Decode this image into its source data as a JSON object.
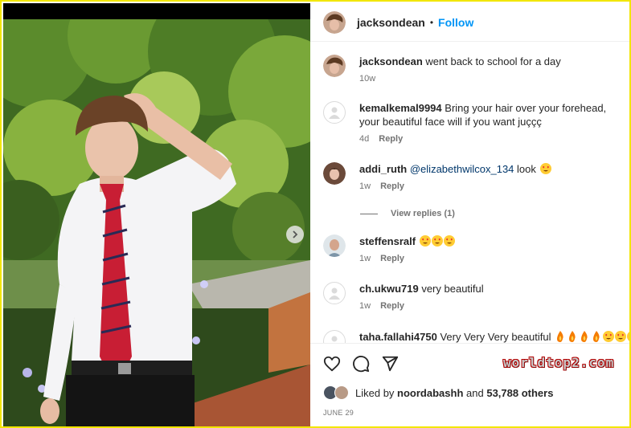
{
  "header": {
    "username": "jacksondean",
    "separator": "•",
    "follow_label": "Follow"
  },
  "caption": {
    "username": "jacksondean",
    "text": "went back to school for a day",
    "time": "10w"
  },
  "comments": [
    {
      "username": "kemalkemal9994",
      "text": "Bring your hair over your forehead, your beautiful face will if you want juççç",
      "time": "4d",
      "reply_label": "Reply"
    },
    {
      "username": "addi_ruth",
      "mention": "@elizabethwilcox_134",
      "text": "look",
      "emoji": "heart-eyes",
      "time": "1w",
      "reply_label": "Reply",
      "view_replies": "View replies (1)"
    },
    {
      "username": "steffensralf",
      "emojis": [
        "heart-eyes",
        "heart-eyes",
        "heart-eyes"
      ],
      "time": "1w",
      "reply_label": "Reply"
    },
    {
      "username": "ch.ukwu719",
      "text": "very beautiful",
      "time": "1w",
      "reply_label": "Reply"
    },
    {
      "username": "taha.fallahi4750",
      "text": "Very Very Very beautiful",
      "emojis": [
        "fire",
        "fire",
        "fire",
        "fire",
        "heart-eyes",
        "heart-eyes",
        "heart-eyes"
      ]
    }
  ],
  "likes": {
    "prefix": "Liked by",
    "liker": "noordabashh",
    "conjunction": "and",
    "count_text": "53,788 others"
  },
  "post_date": "JUNE 29",
  "watermark": "worldtop2.com",
  "icons": {
    "like": "heart-icon",
    "comment": "comment-icon",
    "share": "share-icon",
    "next": "chevron-right-icon"
  },
  "colors": {
    "accent": "#0095f6",
    "border_frame": "#f2e600",
    "emoji_face": "#ffcc33",
    "emoji_heart": "#e8282b",
    "fire": "#f57c00"
  }
}
